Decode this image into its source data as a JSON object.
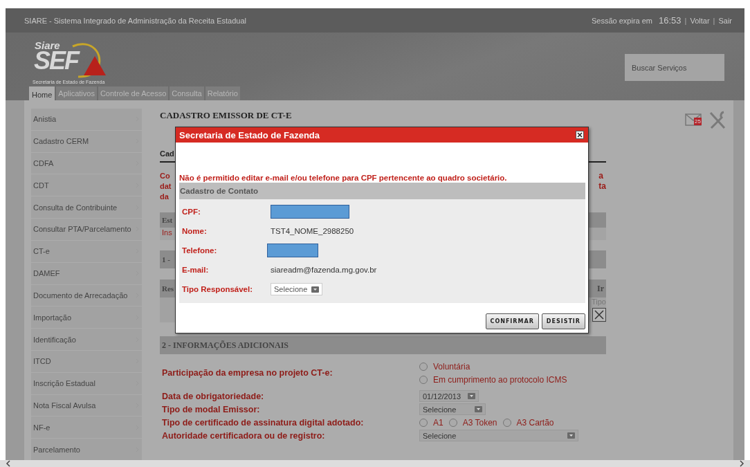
{
  "top_bar": {
    "title": "SIARE - Sistema Integrado de Administração da Receita Estadual",
    "session_label": "Sessão expira em",
    "session_time": "16:53",
    "separator": "|",
    "links": [
      "Voltar",
      "Sair"
    ]
  },
  "header": {
    "logo_small": "Siare",
    "logo_big": "SEF",
    "logo_subtitle": "Secretaria de Estado de Fazenda",
    "search": {
      "placeholder": "Buscar Serviços"
    }
  },
  "tabs": [
    {
      "label": "Home",
      "selected": true
    },
    {
      "label": "Aplicativos",
      "selected": false
    },
    {
      "label": "Controle de Acesso",
      "selected": false
    },
    {
      "label": "Consulta",
      "selected": false
    },
    {
      "label": "Relatório",
      "selected": false
    }
  ],
  "sidebar": {
    "items": [
      "Anistia",
      "Cadastro CERM",
      "CDFA",
      "CDT",
      "Consulta de Contribuinte",
      "Consultar PTA/Parcelamento",
      "CT-e",
      "DAMEF",
      "Documento de Arrecadação",
      "Importação",
      "Identificação",
      "ITCD",
      "Inscrição Estadual",
      "Nota Fiscal Avulsa",
      "NF-e",
      "Parcelamento"
    ]
  },
  "notifications": {
    "count": "25"
  },
  "page": {
    "title": "CADASTRO EMISSOR DE CT-E",
    "covered": {
      "heading": "Cad",
      "notice_left": [
        "Co",
        "dat",
        "da"
      ],
      "notice_right": [
        "a",
        "ta"
      ],
      "status_label": "Est",
      "status_text": "Ins",
      "section_1": "1 -",
      "table_left": "Res",
      "table_right": "Ir",
      "column_label": "Tipo"
    },
    "section_2": {
      "title": "2 - INFORMAÇÕES ADICIONAIS",
      "fields": [
        {
          "kind": "radio_stack",
          "label": "Participação da empresa no projeto CT-e:",
          "options": [
            {
              "label": "Voluntária",
              "selected": false
            },
            {
              "label": "Em cumprimento ao protocolo ICMS",
              "selected": false
            }
          ]
        },
        {
          "kind": "date",
          "label": "Data de obrigatoriedade:",
          "value": "01/12/2013"
        },
        {
          "kind": "select",
          "label": "Tipo de modal Emissor:",
          "value": "Selecione"
        },
        {
          "kind": "radio_row",
          "label": "Tipo de certificado de assinatura digital adotado:",
          "options": [
            {
              "label": "A1",
              "selected": false
            },
            {
              "label": "A3 Token",
              "selected": false
            },
            {
              "label": "A3 Cartão",
              "selected": false
            }
          ]
        },
        {
          "kind": "select_wide",
          "label": "Autoridade certificadora ou de registro:",
          "value": "Selecione"
        }
      ]
    }
  },
  "modal": {
    "title": "Secretaria de Estado de Fazenda",
    "error": "Não é permitido editar e-mail e/ou telefone para CPF pertencente ao quadro societário.",
    "section_title": "Cadastro de Contato",
    "fields": [
      {
        "kind": "redacted",
        "label": "CPF:"
      },
      {
        "kind": "text",
        "label": "Nome:",
        "value": "TST4_NOME_2988250"
      },
      {
        "kind": "redacted_short",
        "label": "Telefone:"
      },
      {
        "kind": "text",
        "label": "E-mail:",
        "value": "siareadm@fazenda.mg.gov.br"
      },
      {
        "kind": "select",
        "label": "Tipo Responsável:",
        "value": "Selecione"
      }
    ],
    "buttons": [
      "CONFIRMAR",
      "DESISTIR"
    ]
  }
}
